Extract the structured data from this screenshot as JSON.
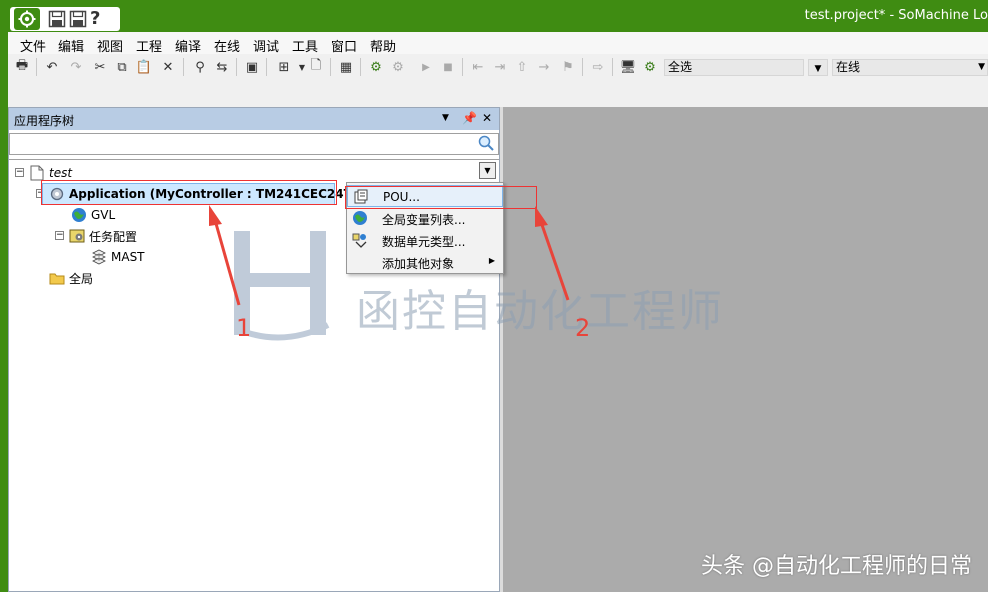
{
  "window": {
    "title": "test.project* - SoMachine Lo"
  },
  "menu": [
    "文件",
    "编辑",
    "视图",
    "工程",
    "编译",
    "在线",
    "调试",
    "工具",
    "窗口",
    "帮助"
  ],
  "toolbar": {
    "select_all": "全选",
    "online": "在线"
  },
  "panel": {
    "title": "应用程序树",
    "search_placeholder": ""
  },
  "tree": {
    "root": "test",
    "application": "Application (MyController : TM241CEC24T/U)",
    "gvl": "GVL",
    "task_config": "任务配置",
    "mast": "MAST",
    "global": "全局"
  },
  "context_menu": {
    "items": [
      "POU...",
      "全局变量列表...",
      "数据单元类型...",
      "添加其他对象"
    ]
  },
  "annotations": {
    "one": "1",
    "two": "2"
  },
  "watermark": "函控自动化工程师",
  "credit": "头条 @自动化工程师的日常",
  "colors": {
    "titlebar": "#3f8c12",
    "panel_header": "#b8cce4",
    "selection": "#cde8ff",
    "annotation_red": "#e8443a",
    "editor_bg": "#ababab"
  }
}
